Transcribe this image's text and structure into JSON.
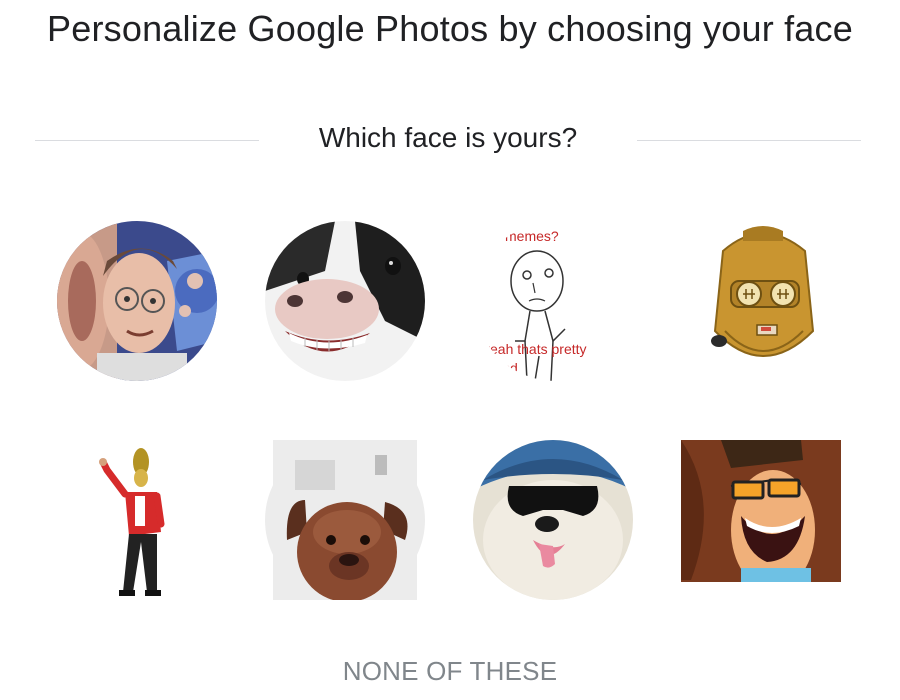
{
  "header": {
    "title": "Personalize Google Photos by choosing your face"
  },
  "prompt": {
    "question": "Which face is yours?"
  },
  "faces": [
    {
      "name": "face-option-1",
      "icon": "distorted-man-face"
    },
    {
      "name": "face-option-2",
      "icon": "smiling-cow-face"
    },
    {
      "name": "face-option-3",
      "icon": "meme-drawing-face",
      "texts": [
        "memes?",
        "yeah thats pretty",
        "cd"
      ]
    },
    {
      "name": "face-option-4",
      "icon": "gold-robot-face"
    },
    {
      "name": "face-option-5",
      "icon": "dancing-person-in-red-jacket"
    },
    {
      "name": "face-option-6",
      "icon": "brown-dog-face"
    },
    {
      "name": "face-option-7",
      "icon": "dog-with-sunglasses-face"
    },
    {
      "name": "face-option-8",
      "icon": "cartoon-man-with-glasses-laughing"
    }
  ],
  "actions": {
    "none_label": "NONE OF THESE"
  },
  "colors": {
    "title": "#202124",
    "divider": "#dadce0",
    "none_button": "#80868b"
  }
}
